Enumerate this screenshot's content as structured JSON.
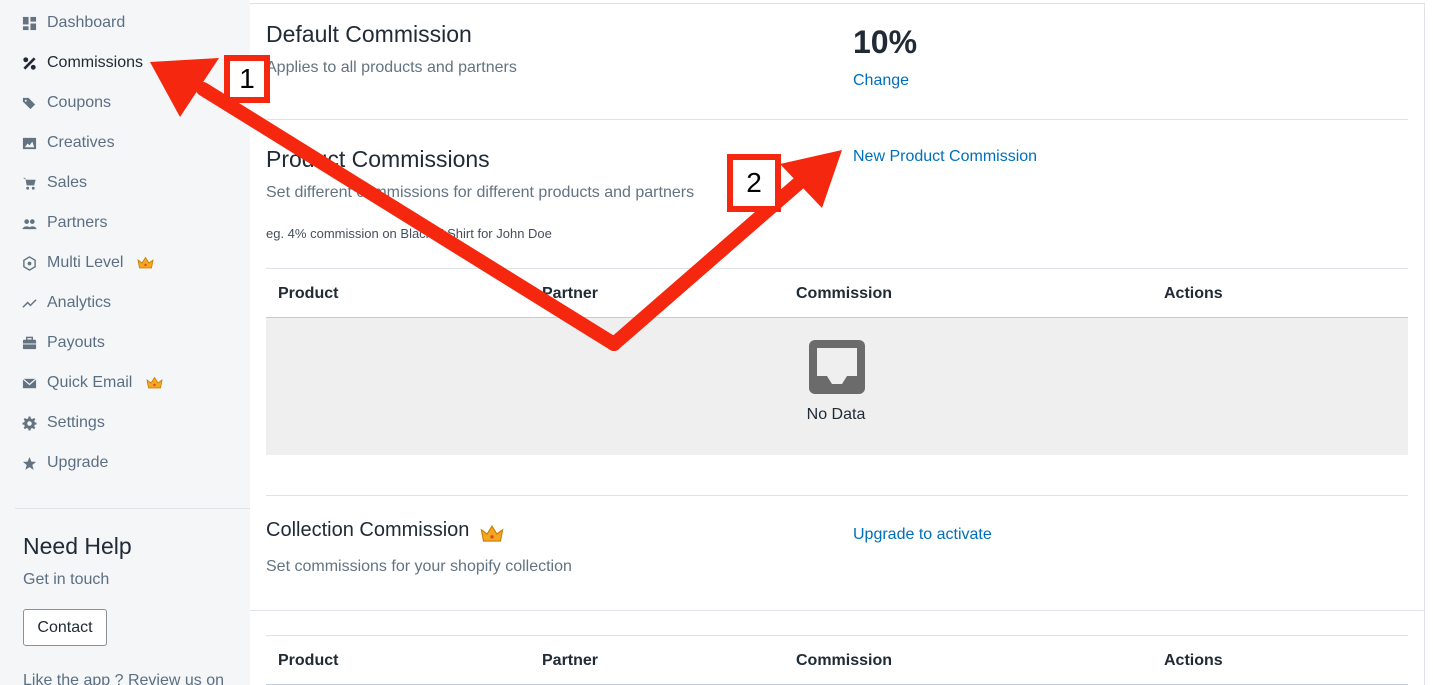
{
  "sidebar": {
    "items": [
      {
        "label": "Dashboard",
        "icon": "dashboard-icon",
        "active": false,
        "crown": false
      },
      {
        "label": "Commissions",
        "icon": "percent-icon",
        "active": true,
        "crown": false
      },
      {
        "label": "Coupons",
        "icon": "tags-icon",
        "active": false,
        "crown": false
      },
      {
        "label": "Creatives",
        "icon": "image-icon",
        "active": false,
        "crown": false
      },
      {
        "label": "Sales",
        "icon": "cart-icon",
        "active": false,
        "crown": false
      },
      {
        "label": "Partners",
        "icon": "people-icon",
        "active": false,
        "crown": false
      },
      {
        "label": "Multi Level",
        "icon": "network-icon",
        "active": false,
        "crown": true
      },
      {
        "label": "Analytics",
        "icon": "trend-icon",
        "active": false,
        "crown": false
      },
      {
        "label": "Payouts",
        "icon": "briefcase-icon",
        "active": false,
        "crown": false
      },
      {
        "label": "Quick Email",
        "icon": "mail-icon",
        "active": false,
        "crown": true
      },
      {
        "label": "Settings",
        "icon": "gear-icon",
        "active": false,
        "crown": false
      },
      {
        "label": "Upgrade",
        "icon": "star-icon",
        "active": false,
        "crown": false
      }
    ],
    "help": {
      "title": "Need Help",
      "subtitle": "Get in touch",
      "contact_label": "Contact",
      "review_text": "Like the app ? Review us on"
    }
  },
  "default_commission": {
    "title": "Default Commission",
    "subtitle": "Applies to all products and partners",
    "value": "10%",
    "change_label": "Change"
  },
  "product_commissions": {
    "title": "Product Commissions",
    "subtitle": "Set different commissions for different products and partners",
    "example": "eg. 4% commission on Black T-Shirt for John Doe",
    "new_label": "New Product Commission",
    "columns": [
      "Product",
      "Partner",
      "Commission",
      "Actions"
    ],
    "empty_text": "No Data"
  },
  "collection_commission": {
    "title": "Collection Commission",
    "subtitle": "Set commissions for your shopify collection",
    "upgrade_label": "Upgrade to activate",
    "columns": [
      "Product",
      "Partner",
      "Commission",
      "Actions"
    ]
  },
  "annotations": {
    "badge_1": "1",
    "badge_2": "2"
  },
  "colors": {
    "accent_link": "#006fbb",
    "annotation_red": "#f5270e",
    "sidebar_bg": "#f4f6f8",
    "crown_gold": "#f5a623"
  }
}
